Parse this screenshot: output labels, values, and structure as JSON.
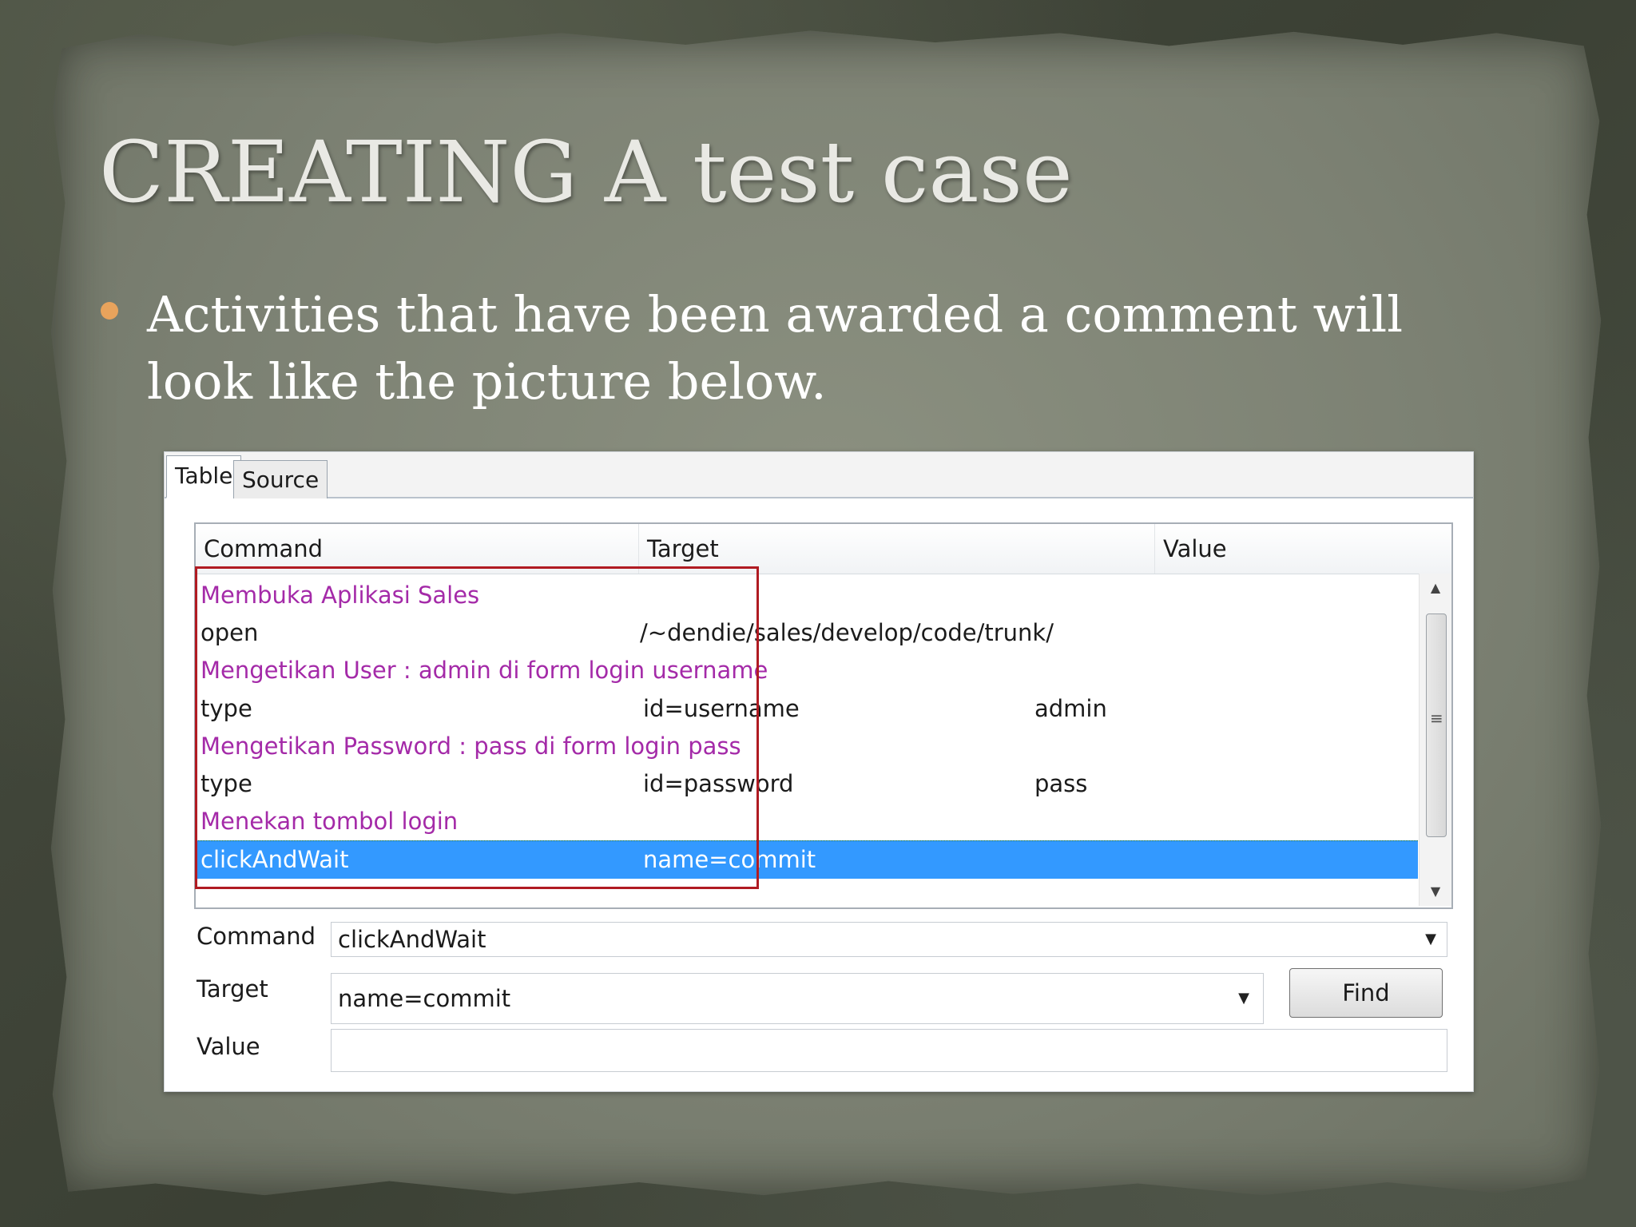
{
  "slide": {
    "title": "CREATING A test case",
    "bullet": "Activities that have been awarded a comment will look like the picture below."
  },
  "editor": {
    "tabs": [
      "Table",
      "Source"
    ],
    "active_tab": "Table",
    "columns": [
      "Command",
      "Target",
      "Value"
    ],
    "rows": [
      {
        "command": "Membuka Aplikasi Sales",
        "target": "",
        "value": "",
        "is_comment": true
      },
      {
        "command": "open",
        "target": "/~dendie/sales/develop/code/trunk/",
        "value": "",
        "is_comment": false
      },
      {
        "command": "Mengetikan User : admin di form login username",
        "target": "",
        "value": "",
        "is_comment": true
      },
      {
        "command": "type",
        "target": "id=username",
        "value": "admin",
        "is_comment": false
      },
      {
        "command": "Mengetikan Password : pass di form login pass",
        "target": "",
        "value": "",
        "is_comment": true
      },
      {
        "command": "type",
        "target": "id=password",
        "value": "pass",
        "is_comment": false
      },
      {
        "command": "Menekan tombol login",
        "target": "",
        "value": "",
        "is_comment": true
      },
      {
        "command": "clickAndWait",
        "target": "name=commit",
        "value": "",
        "is_comment": false,
        "selected": true
      }
    ],
    "form": {
      "command_label": "Command",
      "command_value": "clickAndWait",
      "target_label": "Target",
      "target_value": "name=commit",
      "value_label": "Value",
      "value_value": "",
      "find_label": "Find"
    },
    "colors": {
      "comment_text": "#a42aa8",
      "selection": "#3399ff",
      "highlight_box": "#b01b22",
      "bullet": "#e8a35c"
    }
  }
}
